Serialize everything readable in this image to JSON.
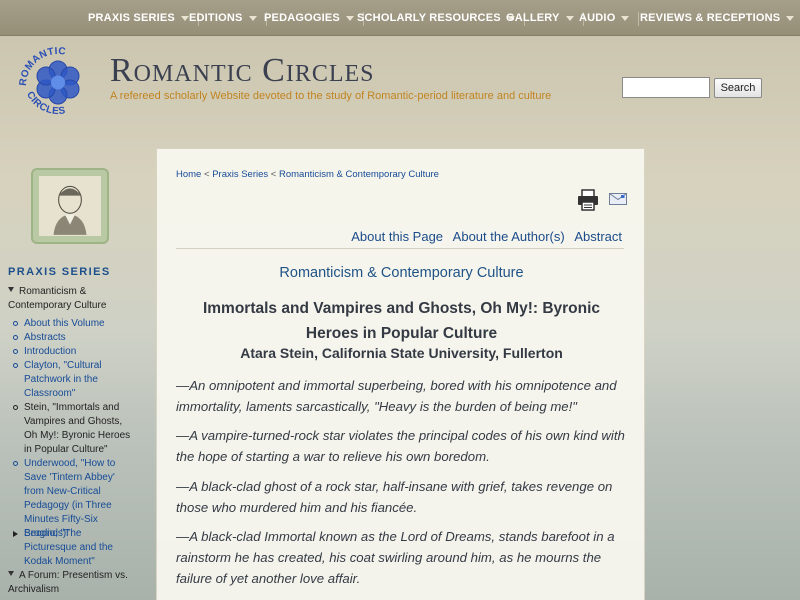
{
  "nav": {
    "items": [
      {
        "label": "PRAXIS SERIES"
      },
      {
        "label": "EDITIONS"
      },
      {
        "label": "PEDAGOGIES"
      },
      {
        "label": "SCHOLARLY RESOURCES"
      },
      {
        "label": "GALLERY"
      },
      {
        "label": "AUDIO"
      },
      {
        "label": "REVIEWS & RECEPTIONS"
      }
    ]
  },
  "header": {
    "logo_text_top": "ROMANTIC",
    "logo_text_bottom": "CIRCLES",
    "title": "Romantic Circles",
    "tagline": "A refereed scholarly Website devoted to the study of Romantic-period literature and culture"
  },
  "search": {
    "placeholder": "",
    "button_label": "Search"
  },
  "sidebar": {
    "heading": "PRAXIS SERIES",
    "current": "Romanticism & Contemporary Culture",
    "items": [
      {
        "label": "About this Volume"
      },
      {
        "label": "Abstracts"
      },
      {
        "label": "Introduction"
      },
      {
        "label": "Clayton, \"Cultural Patchwork in the Classroom\""
      },
      {
        "label": "Stein, \"Immortals and Vampires and Ghosts, Oh My!: Byronic Heroes in Popular Culture\""
      },
      {
        "label": "Underwood, \"How to Save 'Tintern Abbey' from New-Critical Pedagogy (in Three Minutes Fifty-Six Seconds)\""
      },
      {
        "label": "Broglio, \"The Picturesque and the Kodak Moment\""
      }
    ],
    "forum": "A Forum: Presentism vs. Archivalism"
  },
  "breadcrumb": {
    "home": "Home",
    "sep": "<",
    "praxis": "Praxis Series",
    "current": "Romanticism & Contemporary Culture"
  },
  "page_links": {
    "about_page": "About this Page",
    "about_author": "About the Author(s)",
    "abstract": "Abstract"
  },
  "article": {
    "section_title": "Romanticism & Contemporary Culture",
    "title": "Immortals and Vampires and Ghosts, Oh My!: Byronic Heroes in Popular Culture",
    "author": "Atara Stein, California State University, Fullerton",
    "paragraphs": [
      "—An omnipotent and immortal superbeing, bored with his omnipotence and immortality, laments sarcastically, \"Heavy is the burden of being me!\"",
      "—A vampire-turned-rock star violates the principal codes of his own kind with the hope of starting a war to relieve his own boredom.",
      "—A black-clad ghost of a rock star, half-insane with grief, takes revenge on those who murdered him and his fiancée.",
      "—A black-clad Immortal known as the Lord of Dreams, stands barefoot in a rainstorm he has created, his coat swirling around him, as he mourns the failure of yet another love affair."
    ]
  },
  "colors": {
    "nav_bg": "#9b957f",
    "link": "#1b4c8a",
    "tagline": "#c08420",
    "title": "#3b4050"
  }
}
